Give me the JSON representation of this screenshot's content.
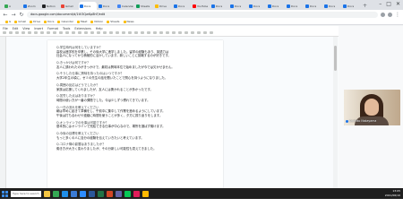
{
  "browser": {
    "tabs": [
      {
        "label": "A",
        "color": "#34a853"
      },
      {
        "label": "Zoom",
        "color": "#1a73e8"
      },
      {
        "label": "Notion",
        "color": "#202124"
      },
      {
        "label": "Gmail",
        "color": "#ea4335"
      },
      {
        "label": "Docs",
        "color": "#1a73e8"
      },
      {
        "label": "Docs",
        "color": "#1a73e8"
      },
      {
        "label": "Calendar",
        "color": "#4285f4"
      },
      {
        "label": "Sheets",
        "color": "#0f9d58"
      },
      {
        "label": "Drive",
        "color": "#fbbc04"
      },
      {
        "label": "Docs",
        "color": "#1a73e8"
      },
      {
        "label": "YouTube",
        "color": "#ff0000"
      },
      {
        "label": "Docs",
        "color": "#1a73e8"
      },
      {
        "label": "Docs",
        "color": "#1a73e8"
      },
      {
        "label": "Docs",
        "color": "#1a73e8"
      },
      {
        "label": "Docs",
        "color": "#1a73e8"
      },
      {
        "label": "Docs",
        "color": "#1a73e8"
      },
      {
        "label": "Docs",
        "color": "#1a73e8"
      },
      {
        "label": "Docs",
        "color": "#1a73e8"
      },
      {
        "label": "Docs",
        "color": "#1a73e8"
      }
    ],
    "url": "docs.google.com/document/d/1tV3QwKp8hF/edit",
    "bookmarks": [
      "G",
      "Gmail",
      "Drive",
      "Docs",
      "Calendar",
      "Meet",
      "Notion",
      "Sheets",
      "News"
    ]
  },
  "docs": {
    "menus": [
      "File",
      "Edit",
      "View",
      "Insert",
      "Format",
      "Tools",
      "Extensions",
      "Help"
    ],
    "share_label": "Share",
    "lines": [
      "Q.学生時代は何をしていますか？",
      "高校は進学校を卒業し、その後大学に進学しました。留学の経験もあり、英語力は",
      "社会人になってから積極的に活かしています。新しいことに挑戦するのが好きです。",
      "Q.きっかけは何ですか？",
      "友人に誘われたのがきっかけで、最初は興味本位で始めましたが今では欠かせません。",
      "Q.そうした仕事に興味を持ったのはいつですか？",
      "大学2年生の頃に、ゼミの先生の話を聞いたことで関心を持つようになりました。",
      "Q.周囲の反応はどうでしたか？",
      "家族は応援してくれましたが、友人には驚かれることが多かったです。",
      "Q.苦労した点はありますか？",
      "時間の使い方が一番の課題でした。今は少しずつ慣れてきています。",
      "Q.一日の流れを教えてください",
      "朝は早めに起きて準備をし、午前中に集中して作業を進めるようにしています。",
      "午後は打ち合わせや連絡に時間を使うことが多く、夕方に振り返りをします。",
      "Q.オンラインでの仕事は可能ですか？",
      "基本的にはオンラインで完結できる仕事が中心なので、場所を選ばず働けます。",
      "Q.今後の目標を教えてください",
      "もっと多くの人に自分の経験を伝えていきたいと考えています。",
      "Q.コロナ禍の影響はありましたか？",
      "働き方が大きく変わりましたが、その分新しい可能性も見えてきました。"
    ]
  },
  "meeting": {
    "participant_name": "Sachiko Nakayama"
  },
  "taskbar": {
    "search_placeholder": "Type here to search",
    "apps": [
      {
        "name": "file-explorer",
        "color": "#f4c542"
      },
      {
        "name": "chrome",
        "color": "#34a853"
      },
      {
        "name": "edge",
        "color": "#1f8ee8"
      },
      {
        "name": "mail",
        "color": "#3a7bd5"
      },
      {
        "name": "zoom",
        "color": "#2d8cff"
      },
      {
        "name": "word",
        "color": "#2b579a"
      },
      {
        "name": "excel",
        "color": "#217346"
      },
      {
        "name": "powerpoint",
        "color": "#d24726"
      },
      {
        "name": "teams",
        "color": "#6264a7"
      },
      {
        "name": "line",
        "color": "#06c755"
      },
      {
        "name": "slack",
        "color": "#e01e5a"
      },
      {
        "name": "notes",
        "color": "#ffb900"
      }
    ],
    "time": "13:05",
    "date": "2021/06/10"
  }
}
